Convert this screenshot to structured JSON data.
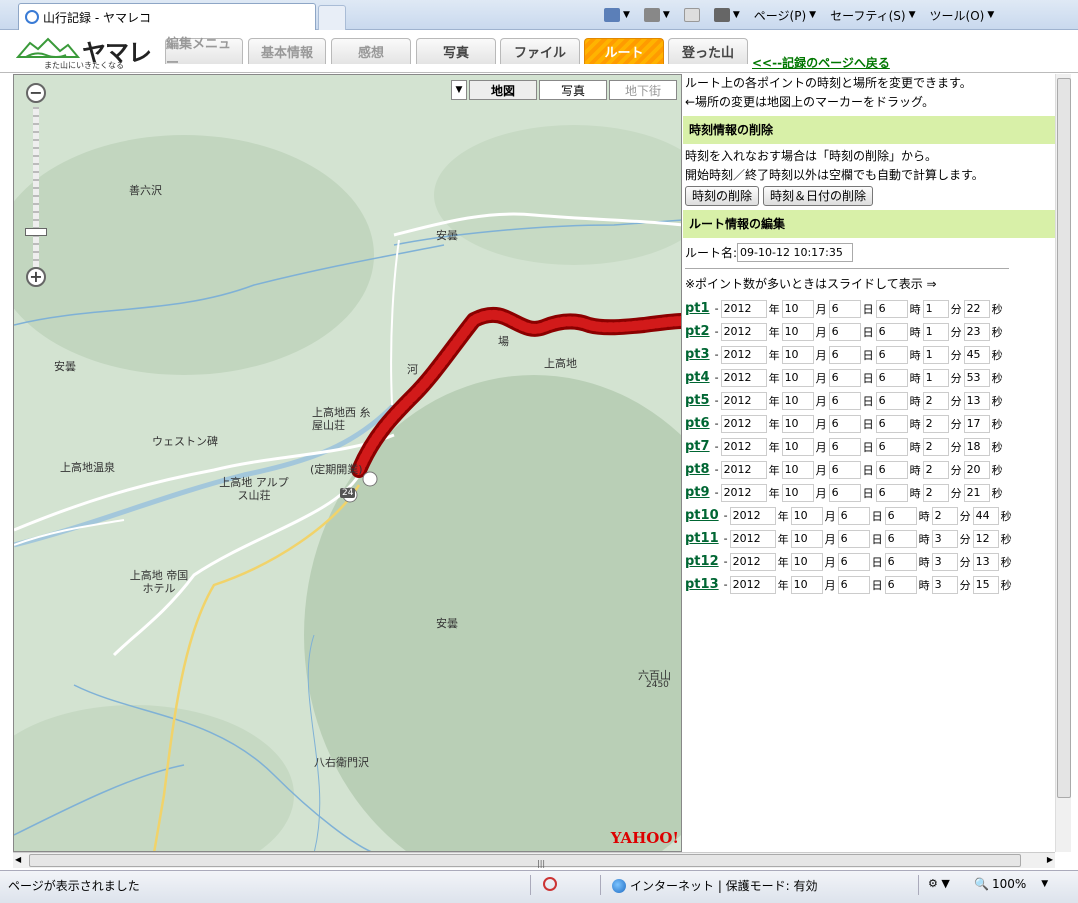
{
  "browser": {
    "tab_title": "山行記録 - ヤマレコ",
    "menu": {
      "page": "ページ(P)",
      "safety": "セーフティ(S)",
      "tools": "ツール(O)"
    }
  },
  "app": {
    "logo_name": "ヤマレコ",
    "logo_sub": "また山にいきたくなる",
    "tabs": [
      "編集メニュー",
      "基本情報",
      "感想",
      "写真",
      "ファイル",
      "ルート",
      "登った山"
    ],
    "active_tab": "ルート",
    "back_link": "<<--記録のページへ戻る"
  },
  "map": {
    "types": [
      "地図",
      "写真",
      "地下街"
    ],
    "selected_type": "地図",
    "labels": [
      "善六沢",
      "安曇",
      "安曇",
      "安曇",
      "上高地",
      "上高地西 糸屋山荘",
      "ウェストン碑",
      "上高地温泉",
      "上高地 アルプス山荘",
      "(定期開業)",
      "上高地 帝国ホテル",
      "八右衛門沢",
      "六百山",
      "2450",
      "河",
      "場",
      "24"
    ],
    "brand": "YAHOO!"
  },
  "panel": {
    "intro1": "ルート上の各ポイントの時刻と場所を変更できます。",
    "intro2": "←場所の変更は地図上のマーカーをドラッグ。",
    "section_time": "時刻情報の削除",
    "time_note1": "時刻を入れなおす場合は「時刻の削除」から。",
    "time_note2": "開始時刻／終了時刻以外は空欄でも自動で計算します。",
    "btn_delete_time": "時刻の削除",
    "btn_delete_time_date": "時刻＆日付の削除",
    "section_route": "ルート情報の編集",
    "route_name_label": "ルート名:",
    "route_name_value": "09-10-12 10:17:35",
    "slide_note": "※ポイント数が多いときはスライドして表示 ⇒",
    "units": {
      "year": "年",
      "month": "月",
      "day": "日",
      "hour": "時",
      "minute": "分",
      "second": "秒"
    },
    "points": [
      {
        "label": "pt1",
        "y": "2012",
        "mo": "10",
        "d": "6",
        "h": "6",
        "mi": "1",
        "s": "22"
      },
      {
        "label": "pt2",
        "y": "2012",
        "mo": "10",
        "d": "6",
        "h": "6",
        "mi": "1",
        "s": "23"
      },
      {
        "label": "pt3",
        "y": "2012",
        "mo": "10",
        "d": "6",
        "h": "6",
        "mi": "1",
        "s": "45"
      },
      {
        "label": "pt4",
        "y": "2012",
        "mo": "10",
        "d": "6",
        "h": "6",
        "mi": "1",
        "s": "53"
      },
      {
        "label": "pt5",
        "y": "2012",
        "mo": "10",
        "d": "6",
        "h": "6",
        "mi": "2",
        "s": "13"
      },
      {
        "label": "pt6",
        "y": "2012",
        "mo": "10",
        "d": "6",
        "h": "6",
        "mi": "2",
        "s": "17"
      },
      {
        "label": "pt7",
        "y": "2012",
        "mo": "10",
        "d": "6",
        "h": "6",
        "mi": "2",
        "s": "18"
      },
      {
        "label": "pt8",
        "y": "2012",
        "mo": "10",
        "d": "6",
        "h": "6",
        "mi": "2",
        "s": "20"
      },
      {
        "label": "pt9",
        "y": "2012",
        "mo": "10",
        "d": "6",
        "h": "6",
        "mi": "2",
        "s": "21"
      },
      {
        "label": "pt10",
        "y": "2012",
        "mo": "10",
        "d": "6",
        "h": "6",
        "mi": "2",
        "s": "44"
      },
      {
        "label": "pt11",
        "y": "2012",
        "mo": "10",
        "d": "6",
        "h": "6",
        "mi": "3",
        "s": "12"
      },
      {
        "label": "pt12",
        "y": "2012",
        "mo": "10",
        "d": "6",
        "h": "6",
        "mi": "3",
        "s": "13"
      },
      {
        "label": "pt13",
        "y": "2012",
        "mo": "10",
        "d": "6",
        "h": "6",
        "mi": "3",
        "s": "15"
      }
    ]
  },
  "status": {
    "text": "ページが表示されました",
    "zone": "インターネット | 保護モード: 有効",
    "zoom": "100%"
  }
}
